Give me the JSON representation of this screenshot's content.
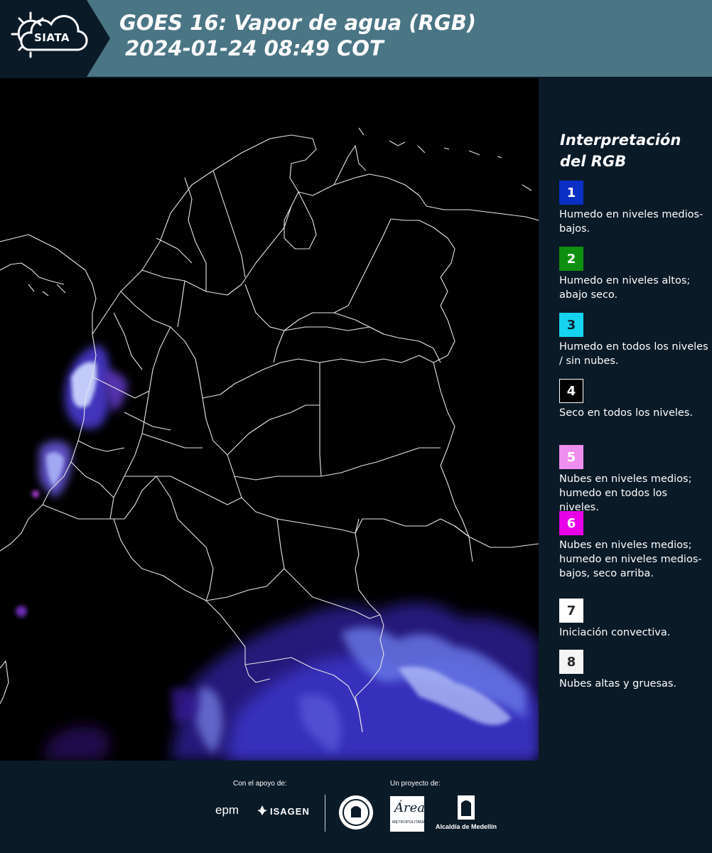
{
  "header": {
    "logo": "SIATA",
    "title_line1": "GOES 16: Vapor de agua (RGB)",
    "title_line2": "2024-01-24 08:49 COT"
  },
  "legend": {
    "title": "Interpretación del RGB",
    "items": [
      {
        "number": "1",
        "color": "#0a2fc4",
        "text_color": "#ffffff",
        "description": "Humedo en niveles medios-bajos."
      },
      {
        "number": "2",
        "color": "#0f8f0f",
        "text_color": "#ffffff",
        "description": "Humedo en niveles altos; abajo seco."
      },
      {
        "number": "3",
        "color": "#16d4ef",
        "text_color": "#0b2530",
        "description": "Humedo en todos los niveles / sin nubes."
      },
      {
        "number": "4",
        "color": "#000000",
        "text_color": "#ffffff",
        "description": "Seco en todos los niveles."
      },
      {
        "number": "5",
        "color": "#f08ef0",
        "text_color": "#ffffff",
        "description": "Nubes en niveles medios; humedo en todos los niveles."
      },
      {
        "number": "6",
        "color": "#e600e6",
        "text_color": "#ffffff",
        "description": "Nubes en niveles medios; humedo en niveles medios-bajos, seco arriba."
      },
      {
        "number": "7",
        "color": "#ffffff",
        "text_color": "#2a2a2a",
        "description": "Iniciación convectiva."
      },
      {
        "number": "8",
        "color": "#f5f5f5",
        "text_color": "#2a2a2a",
        "description": "Nubes altas y gruesas."
      }
    ]
  },
  "footer": {
    "support_label": "Con el apoyo de:",
    "project_label": "Un proyecto de:",
    "epm": "epm",
    "isagen": "ISAGEN",
    "area_metropolitana": "Área",
    "area_sub": "METROPOLITANA",
    "alcaldia": "Alcaldía de Medellín"
  },
  "icons": [
    "siata-sun-cloud-logo",
    "epm-logo",
    "isagen-logo",
    "gobernacion-seal-logo",
    "area-metropolitana-logo",
    "alcaldia-medellin-logo"
  ]
}
